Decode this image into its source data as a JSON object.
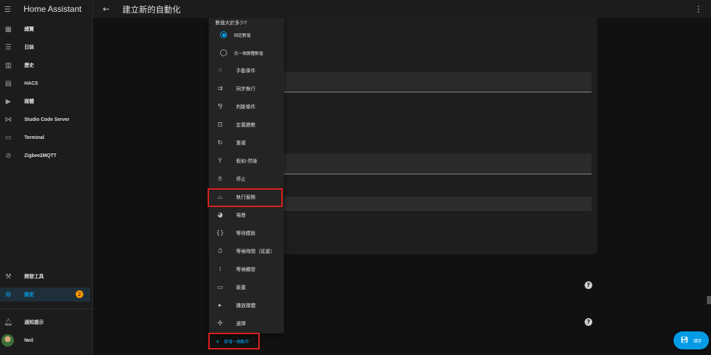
{
  "sidebar": {
    "title": "Home Assistant",
    "items": [
      {
        "label": "總覽",
        "icon": "dashboard-icon"
      },
      {
        "label": "日誌",
        "icon": "list-icon"
      },
      {
        "label": "歷史",
        "icon": "chart-icon"
      },
      {
        "label": "HACS",
        "icon": "store-icon"
      },
      {
        "label": "媒體",
        "icon": "media-icon"
      },
      {
        "label": "Studio Code Server",
        "icon": "vscode-icon"
      },
      {
        "label": "Terminal",
        "icon": "terminal-icon"
      },
      {
        "label": "Zigbee2MQTT",
        "icon": "zigbee-icon"
      }
    ],
    "dev_tools": "開發工具",
    "settings": "設定",
    "settings_badge": "2",
    "notifications": "通知提示",
    "user": "Neil"
  },
  "header": {
    "title": "建立新的自動化"
  },
  "menu": {
    "question": "數值大於多少?",
    "radio_fixed": "固定數值",
    "radio_entity": "另一個實體數值",
    "items": [
      {
        "label": "手動事件"
      },
      {
        "label": "同步執行"
      },
      {
        "label": "判斷條件"
      },
      {
        "label": "定義變數"
      },
      {
        "label": "重複"
      },
      {
        "label": "假如-然後"
      },
      {
        "label": "停止"
      },
      {
        "label": "執行服務"
      },
      {
        "label": "場景"
      },
      {
        "label": "等待模板"
      },
      {
        "label": "等候時間（延遲）"
      },
      {
        "label": "等候觸發"
      },
      {
        "label": "裝置"
      },
      {
        "label": "播放媒體"
      },
      {
        "label": "選擇"
      }
    ]
  },
  "actions": {
    "add_action": "新增一個動作",
    "save": "儲存"
  },
  "colors": {
    "accent": "#03a9f4",
    "highlight": "#e02020",
    "badge": "#ff9800"
  }
}
